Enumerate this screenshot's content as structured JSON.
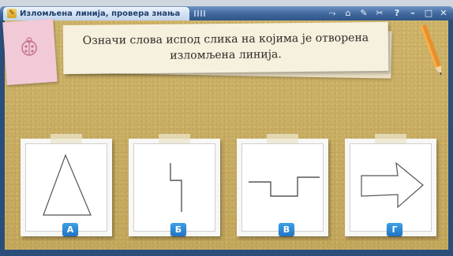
{
  "window": {
    "title": "Изломљена линија, провера знања",
    "tools": [
      "share-icon",
      "presentation-icon",
      "pen-icon",
      "settings-icon",
      "help-icon",
      "minimize-icon",
      "maximize-icon",
      "close-icon"
    ],
    "tool_glyphs": [
      "⤳",
      "⌂",
      "✎",
      "✂",
      "?",
      "–",
      "□",
      "✕"
    ]
  },
  "instruction": {
    "line1": "Означи слова испод слика на којима је отворена",
    "line2": "изломљена линија."
  },
  "options": [
    {
      "letter": "А",
      "shape": "triangle"
    },
    {
      "letter": "Б",
      "shape": "zigzag"
    },
    {
      "letter": "В",
      "shape": "step"
    },
    {
      "letter": "Г",
      "shape": "arrow"
    }
  ],
  "colors": {
    "accent": "#1f74c4",
    "titlebar": "#3f679d",
    "board": "#c8ad62"
  }
}
